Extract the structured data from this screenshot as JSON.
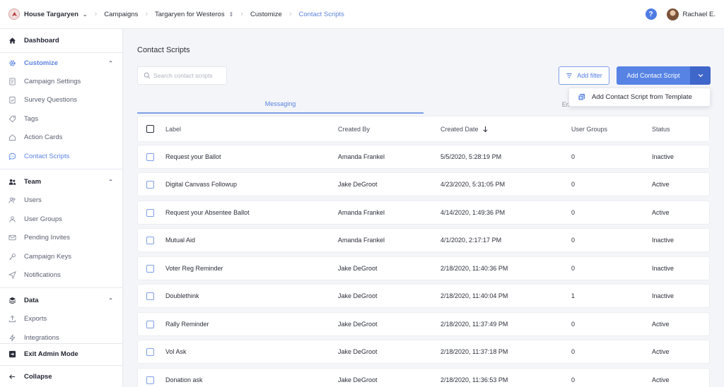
{
  "topbar": {
    "org": "House Targaryen",
    "crumbs": [
      "Campaigns",
      "Targaryen for Westeros",
      "Customize",
      "Contact Scripts"
    ],
    "user_name": "Rachael E.",
    "help_label": "?"
  },
  "sidebar": {
    "dashboard": "Dashboard",
    "customize": {
      "label": "Customize",
      "items": [
        "Campaign Settings",
        "Survey Questions",
        "Tags",
        "Action Cards",
        "Contact Scripts"
      ]
    },
    "team": {
      "label": "Team",
      "items": [
        "Users",
        "User Groups",
        "Pending Invites",
        "Campaign Keys",
        "Notifications"
      ]
    },
    "data": {
      "label": "Data",
      "items": [
        "Exports",
        "Integrations"
      ]
    },
    "exit_admin": "Exit Admin Mode",
    "collapse": "Collapse"
  },
  "main": {
    "title": "Contact Scripts",
    "search_placeholder": "Search contact scripts",
    "add_filter": "Add filter",
    "add_contact_script": "Add Contact Script",
    "dropdown_item": "Add Contact Script from Template",
    "tabs": [
      "Messaging",
      "Em"
    ],
    "columns": [
      "Label",
      "Created By",
      "Created Date",
      "User Groups",
      "Status"
    ],
    "rows": [
      {
        "label": "Request your Ballot",
        "created_by": "Amanda Frankel",
        "created_date": "5/5/2020, 5:28:19 PM",
        "user_groups": "0",
        "status": "Inactive"
      },
      {
        "label": "Digital Canvass Followup",
        "created_by": "Jake DeGroot",
        "created_date": "4/23/2020, 5:31:05 PM",
        "user_groups": "0",
        "status": "Active"
      },
      {
        "label": "Request your Absentee Ballot",
        "created_by": "Amanda Frankel",
        "created_date": "4/14/2020, 1:49:36 PM",
        "user_groups": "0",
        "status": "Active"
      },
      {
        "label": "Mutual Aid",
        "created_by": "Amanda Frankel",
        "created_date": "4/1/2020, 2:17:17 PM",
        "user_groups": "0",
        "status": "Inactive"
      },
      {
        "label": "Voter Reg Reminder",
        "created_by": "Jake DeGroot",
        "created_date": "2/18/2020, 11:40:36 PM",
        "user_groups": "0",
        "status": "Inactive"
      },
      {
        "label": "Doublethink",
        "created_by": "Jake DeGroot",
        "created_date": "2/18/2020, 11:40:04 PM",
        "user_groups": "1",
        "status": "Inactive"
      },
      {
        "label": "Rally Reminder",
        "created_by": "Jake DeGroot",
        "created_date": "2/18/2020, 11:37:49 PM",
        "user_groups": "0",
        "status": "Active"
      },
      {
        "label": "Vol Ask",
        "created_by": "Jake DeGroot",
        "created_date": "2/18/2020, 11:37:18 PM",
        "user_groups": "0",
        "status": "Active"
      },
      {
        "label": "Donation ask",
        "created_by": "Jake DeGroot",
        "created_date": "2/18/2020, 11:36:53 PM",
        "user_groups": "0",
        "status": "Active"
      }
    ]
  },
  "icons": {
    "logo": "dragon-logo-icon",
    "search": "search-icon",
    "filter": "filter-icon",
    "sort": "arrow-down-icon",
    "dropdown": "chevron-down-icon"
  },
  "colors": {
    "accent": "#5b84e0",
    "primary_button": "#5683e4",
    "primary_button_dark": "#3f66c9",
    "help": "#4f7be4"
  }
}
